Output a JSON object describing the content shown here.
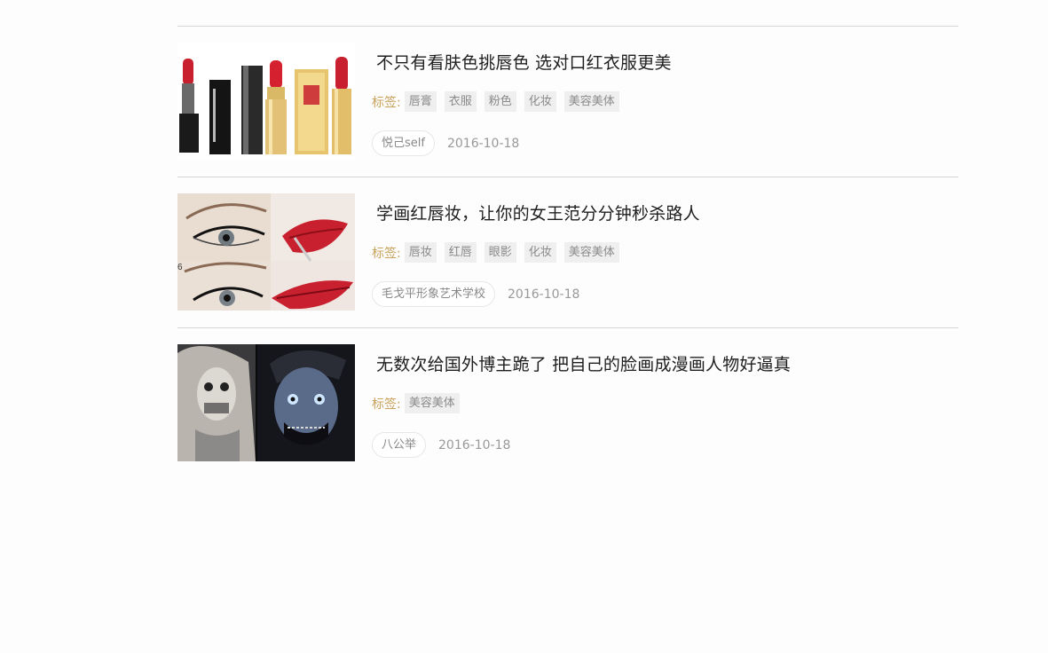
{
  "articles": [
    {
      "title": "不只有看肤色挑唇色 选对口红衣服更美",
      "image": "lipsticks-image",
      "tags_label": "标签:",
      "tags": [
        "唇膏",
        "衣服",
        "粉色",
        "化妆",
        "美容美体"
      ],
      "source": "悦己self",
      "date": "2016-10-18"
    },
    {
      "title": "学画红唇妆，让你的女王范分分钟秒杀路人",
      "image": "red-lips-eyeliner-image",
      "image_text": "6",
      "tags_label": "标签:",
      "tags": [
        "唇妆",
        "红唇",
        "眼影",
        "化妆",
        "美容美体"
      ],
      "source": "毛戈平形象艺术学校",
      "date": "2016-10-18"
    },
    {
      "title": "无数次给国外博主跪了 把自己的脸画成漫画人物好逼真",
      "image": "comic-makeup-faces-image",
      "tags_label": "标签:",
      "tags": [
        "美容美体"
      ],
      "source": "八公举",
      "date": "2016-10-18"
    }
  ],
  "colors": {
    "tag_label": "#c9a25c",
    "tag_bg": "#efefef",
    "divider": "#d6d6d6",
    "lipstick_red": "#c8202e"
  }
}
